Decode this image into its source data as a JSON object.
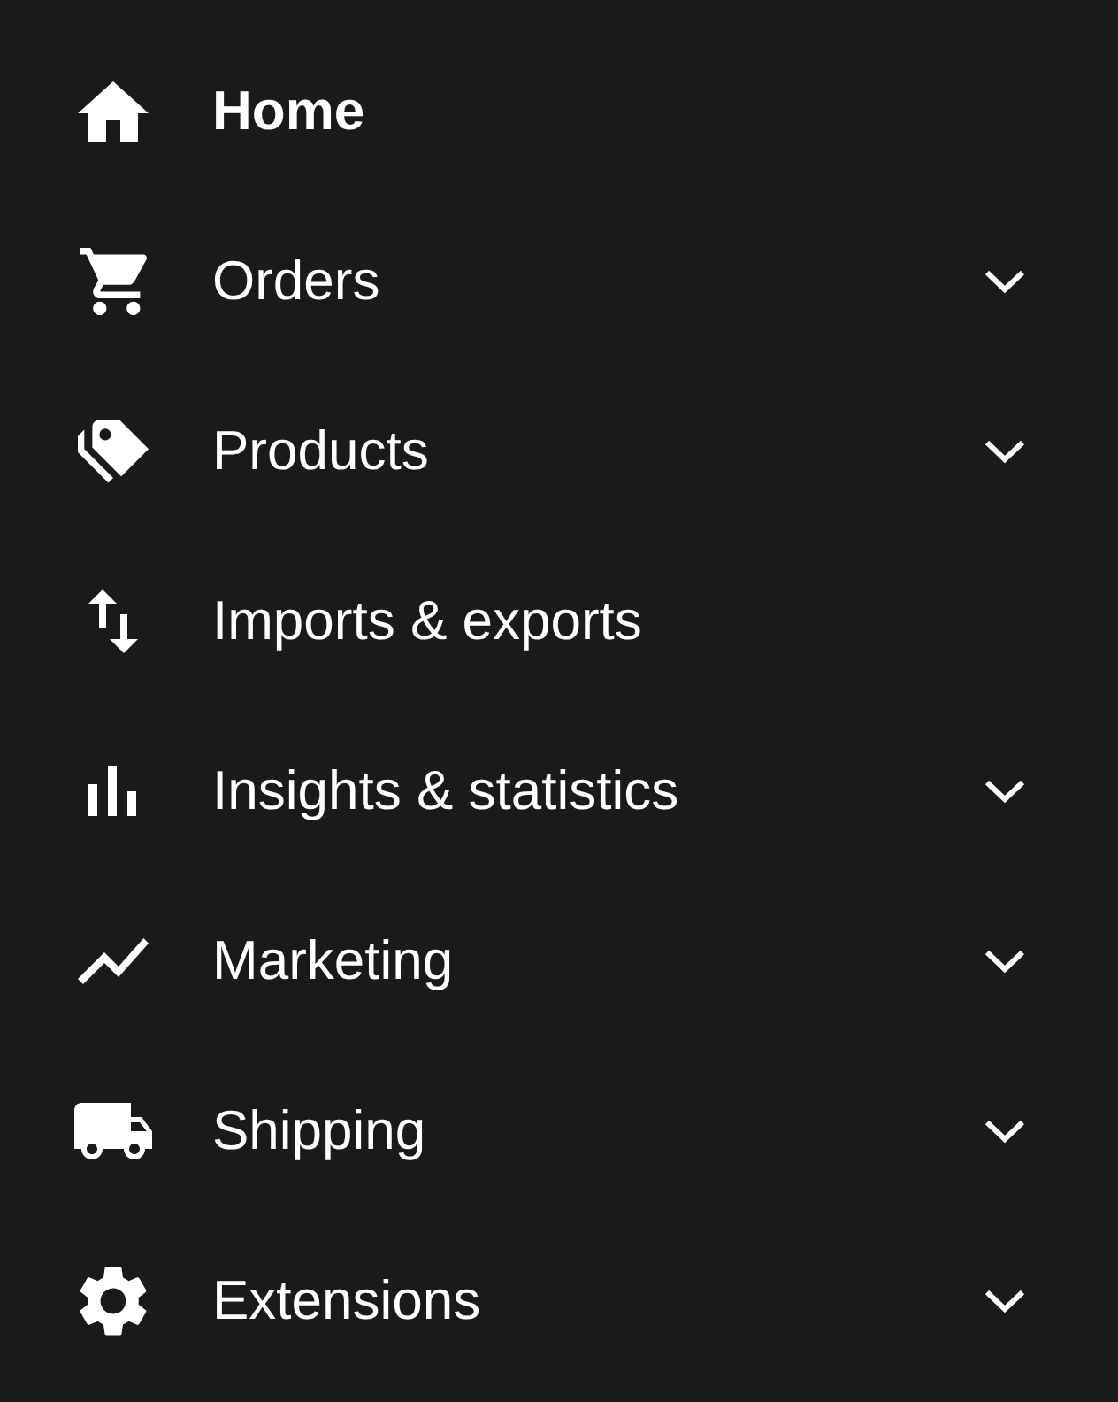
{
  "sidebar": {
    "items": [
      {
        "label": "Home",
        "selected": true,
        "expandable": false
      },
      {
        "label": "Orders",
        "selected": false,
        "expandable": true
      },
      {
        "label": "Products",
        "selected": false,
        "expandable": true
      },
      {
        "label": "Imports & exports",
        "selected": false,
        "expandable": false
      },
      {
        "label": "Insights & statistics",
        "selected": false,
        "expandable": true
      },
      {
        "label": "Marketing",
        "selected": false,
        "expandable": true
      },
      {
        "label": "Shipping",
        "selected": false,
        "expandable": true
      },
      {
        "label": "Extensions",
        "selected": false,
        "expandable": true
      }
    ]
  }
}
